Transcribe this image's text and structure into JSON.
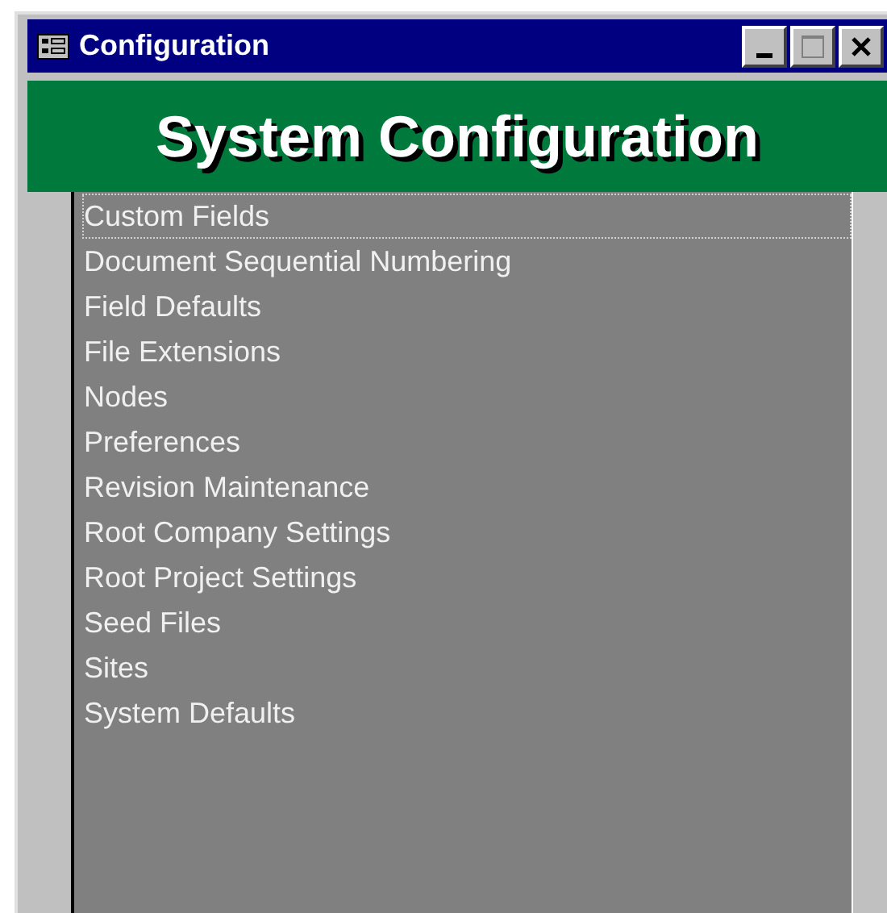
{
  "window": {
    "title": "Configuration"
  },
  "header": {
    "title": "System Configuration"
  },
  "list": {
    "items": [
      {
        "label": "Custom Fields",
        "focused": true
      },
      {
        "label": "Document Sequential Numbering",
        "focused": false
      },
      {
        "label": "Field Defaults",
        "focused": false
      },
      {
        "label": "File Extensions",
        "focused": false
      },
      {
        "label": "Nodes",
        "focused": false
      },
      {
        "label": "Preferences",
        "focused": false
      },
      {
        "label": "Revision Maintenance",
        "focused": false
      },
      {
        "label": "Root Company Settings",
        "focused": false
      },
      {
        "label": "Root Project Settings",
        "focused": false
      },
      {
        "label": "Seed Files",
        "focused": false
      },
      {
        "label": "Sites",
        "focused": false
      },
      {
        "label": "System Defaults",
        "focused": false
      }
    ]
  }
}
